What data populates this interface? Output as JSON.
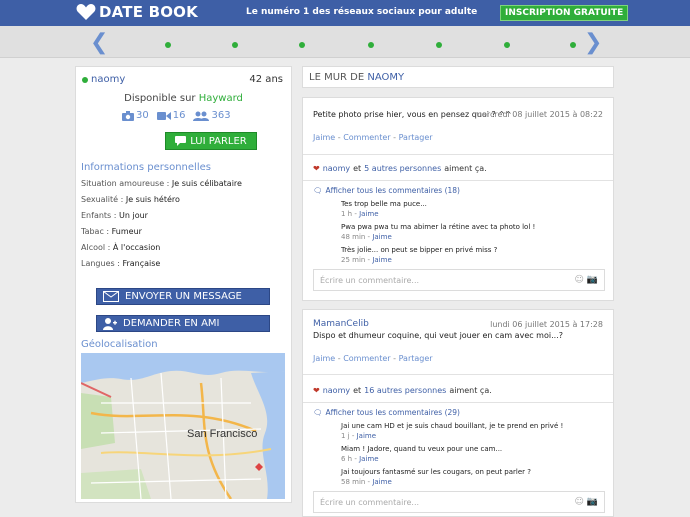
{
  "header": {
    "logo_text": "DATE BOOK",
    "tagline": "Le numéro 1 des réseaux sociaux pour adulte",
    "signup_label": "INSCRIPTION GRATUITE"
  },
  "carousel": {
    "prev_icon": "chevron-left-icon",
    "next_icon": "chevron-right-icon",
    "dot_count": 7
  },
  "profile": {
    "username": "naomy",
    "age": "42 ans",
    "available_prefix": "Disponible sur",
    "city": "Hayward",
    "photos_count": "30",
    "videos_count": "16",
    "friends_count": "363",
    "talk_label": "LUI PARLER",
    "info_heading": "Informations personnelles",
    "info": [
      {
        "label": "Situation amoureuse :",
        "value": "Je suis célibataire"
      },
      {
        "label": "Sexualité :",
        "value": "Je suis hétéro"
      },
      {
        "label": "Enfants :",
        "value": "Un jour"
      },
      {
        "label": "Tabac :",
        "value": "Fumeur"
      },
      {
        "label": "Alcool :",
        "value": "À l'occasion"
      },
      {
        "label": "Langues :",
        "value": "Française"
      }
    ],
    "send_message_label": "ENVOYER UN MESSAGE",
    "add_friend_label": "DEMANDER EN AMI",
    "geo_heading": "Géolocalisation",
    "map_label": "San Francisco"
  },
  "wall": {
    "heading_prefix": "LE MUR DE",
    "heading_name": "NAOMY",
    "actions": {
      "like": "Jaime",
      "comment": "Commenter",
      "share": "Partager"
    },
    "comment_placeholder": "Écrire un commentaire...",
    "posts": [
      {
        "author": "",
        "date": "mercredi 08 juillet 2015 à 08:22",
        "text": "Petite photo prise hier, vous en pensez quoi ? ^^",
        "likes_user": "naomy",
        "likes_others": "5 autres personnes",
        "likes_suffix": "aiment ça.",
        "show_comments": "Afficher tous les commentaires (18)",
        "comments": [
          {
            "text": "Tes trop belle ma puce...",
            "time": "1 h -",
            "like": "Jaime"
          },
          {
            "text": "Pwa pwa pwa tu ma abimer la rétine avec ta photo lol !",
            "time": "48 min -",
            "like": "Jaime"
          },
          {
            "text": "Très jolie... on peut se bipper en privé miss ?",
            "time": "25 min -",
            "like": "Jaime"
          }
        ]
      },
      {
        "author": "MamanCelib",
        "date": "lundi 06 juillet 2015 à 17:28",
        "text": "Dispo et dhumeur coquine, qui veut jouer en cam avec moi...?",
        "likes_user": "naomy",
        "likes_others": "16 autres personnes",
        "likes_suffix": "aiment ça.",
        "show_comments": "Afficher tous les commentaires (29)",
        "comments": [
          {
            "text": "Jai une cam HD et je suis chaud bouillant, je te prend en privé !",
            "time": "1 j -",
            "like": "Jaime"
          },
          {
            "text": "Miam ! Jadore, quand tu veux pour une cam...",
            "time": "6 h -",
            "like": "Jaime"
          },
          {
            "text": "Jai toujours fantasmé sur les cougars, on peut parler ?",
            "time": "58 min -",
            "like": "Jaime"
          }
        ]
      }
    ]
  },
  "colors": {
    "brand_blue": "#3e5fa6",
    "accent_green": "#2fae3a",
    "link_blue": "#6a8fcf"
  }
}
